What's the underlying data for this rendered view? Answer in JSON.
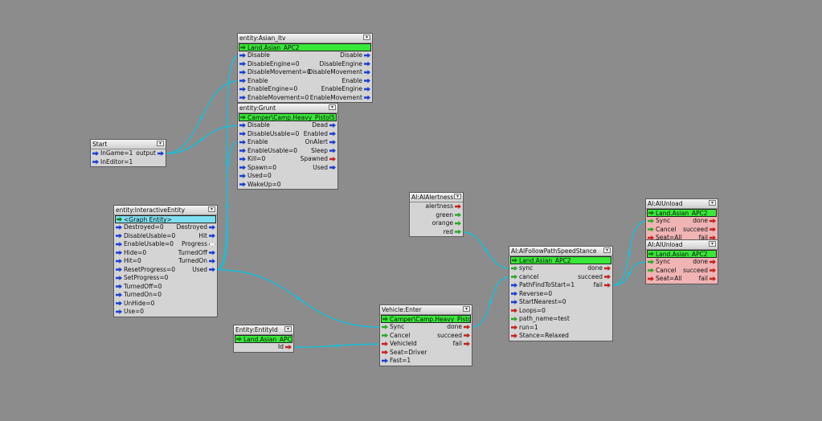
{
  "nodes": {
    "start": {
      "title": "Start",
      "inputs": [
        {
          "label": "InGame=1",
          "color": "blue"
        },
        {
          "label": "InEditor=1",
          "color": "blue"
        }
      ],
      "outputs": [
        {
          "label": "output",
          "color": "blue"
        }
      ]
    },
    "asian_ltv": {
      "title": "entity:Asian_ltv",
      "entity": "Land.Asian_APC2",
      "inputs": [
        {
          "label": "Disable",
          "color": "blue"
        },
        {
          "label": "DisableEngine=0",
          "color": "blue"
        },
        {
          "label": "DisableMovement=0",
          "color": "blue"
        },
        {
          "label": "Enable",
          "color": "blue"
        },
        {
          "label": "EnableEngine=0",
          "color": "blue"
        },
        {
          "label": "EnableMovement=0",
          "color": "blue"
        }
      ],
      "outputs": [
        {
          "label": "Disable",
          "color": "blue"
        },
        {
          "label": "DisableEngine",
          "color": "blue"
        },
        {
          "label": "DisableMovement",
          "color": "blue"
        },
        {
          "label": "Enable",
          "color": "blue"
        },
        {
          "label": "EnableEngine",
          "color": "blue"
        },
        {
          "label": "EnableMovement",
          "color": "blue"
        }
      ]
    },
    "grunt": {
      "title": "entity:Grunt",
      "entity": "Camper\\Camp.Heavy_Pistol5",
      "inputs": [
        {
          "label": "Disable",
          "color": "blue"
        },
        {
          "label": "DisableUsable=0",
          "color": "blue"
        },
        {
          "label": "Enable",
          "color": "blue"
        },
        {
          "label": "EnableUsable=0",
          "color": "blue"
        },
        {
          "label": "Kill=0",
          "color": "blue"
        },
        {
          "label": "Spawn=0",
          "color": "blue"
        },
        {
          "label": "Used=0",
          "color": "blue"
        },
        {
          "label": "WakeUp=0",
          "color": "blue"
        }
      ],
      "outputs": [
        {
          "label": "Dead",
          "color": "blue"
        },
        {
          "label": "Enabled",
          "color": "blue"
        },
        {
          "label": "OnAlert",
          "color": "blue"
        },
        {
          "label": "Sleep",
          "color": "blue"
        },
        {
          "label": "Spawned",
          "color": "red"
        },
        {
          "label": "Used",
          "color": "blue"
        }
      ]
    },
    "interactive": {
      "title": "entity:InteractiveEntity",
      "entity": "<Graph Entity>",
      "inputs": [
        {
          "label": "Destroyed=0",
          "color": "blue"
        },
        {
          "label": "DisableUsable=0",
          "color": "blue"
        },
        {
          "label": "EnableUsable=0",
          "color": "blue"
        },
        {
          "label": "Hide=0",
          "color": "blue"
        },
        {
          "label": "Hit=0",
          "color": "blue"
        },
        {
          "label": "ResetProgress=0",
          "color": "blue"
        },
        {
          "label": "SetProgress=0",
          "color": "blue"
        },
        {
          "label": "TurnedOff=0",
          "color": "blue"
        },
        {
          "label": "TurnedOn=0",
          "color": "blue"
        },
        {
          "label": "UnHide=0",
          "color": "blue"
        },
        {
          "label": "Use=0",
          "color": "blue"
        }
      ],
      "outputs": [
        {
          "label": "Destroyed",
          "color": "blue"
        },
        {
          "label": "Hit",
          "color": "blue"
        },
        {
          "label": "Progress",
          "color": "white"
        },
        {
          "label": "TurnedOff",
          "color": "blue"
        },
        {
          "label": "TurnedOn",
          "color": "blue"
        },
        {
          "label": "Used",
          "color": "blue"
        }
      ]
    },
    "entity_id": {
      "title": "Entity:EntityId",
      "entity": "Land.Asian_APC2",
      "inputs": [],
      "outputs": [
        {
          "label": "Id",
          "color": "red"
        }
      ]
    },
    "vehicle_enter": {
      "title": "Vehicle:Enter",
      "entity": "Camper\\Camp.Heavy_Pistol5",
      "inputs": [
        {
          "label": "Sync",
          "color": "green"
        },
        {
          "label": "Cancel",
          "color": "green"
        },
        {
          "label": "VehicleId",
          "color": "red"
        },
        {
          "label": "Seat=Driver",
          "color": "red"
        },
        {
          "label": "Fast=1",
          "color": "blue"
        }
      ],
      "outputs": [
        {
          "label": "done",
          "color": "red"
        },
        {
          "label": "succeed",
          "color": "red"
        },
        {
          "label": "fail",
          "color": "red"
        }
      ]
    },
    "ai_alertness": {
      "title": "AI:AIAlertness",
      "inputs": [],
      "outputs": [
        {
          "label": "alertness",
          "color": "red"
        },
        {
          "label": "green",
          "color": "green"
        },
        {
          "label": "orange",
          "color": "green"
        },
        {
          "label": "red",
          "color": "green"
        }
      ]
    },
    "follow_path": {
      "title": "AI:AIFollowPathSpeedStance",
      "entity": "Land.Asian_APC2",
      "inputs": [
        {
          "label": "sync",
          "color": "green"
        },
        {
          "label": "cancel",
          "color": "green"
        },
        {
          "label": "PathFindToStart=1",
          "color": "blue"
        },
        {
          "label": "Reverse=0",
          "color": "blue"
        },
        {
          "label": "StartNearest=0",
          "color": "blue"
        },
        {
          "label": "Loops=0",
          "color": "red"
        },
        {
          "label": "path_name=test",
          "color": "green"
        },
        {
          "label": "run=1",
          "color": "red"
        },
        {
          "label": "Stance=Relaxed",
          "color": "red"
        }
      ],
      "outputs": [
        {
          "label": "done",
          "color": "red"
        },
        {
          "label": "succeed",
          "color": "red"
        },
        {
          "label": "fail",
          "color": "red"
        }
      ]
    },
    "ai_unload1": {
      "title": "AI:AIUnload",
      "entity": "Land.Asian_APC2",
      "inputs": [
        {
          "label": "Sync",
          "color": "green"
        },
        {
          "label": "Cancel",
          "color": "green"
        },
        {
          "label": "Seat=All",
          "color": "red"
        }
      ],
      "outputs": [
        {
          "label": "done",
          "color": "red"
        },
        {
          "label": "succeed",
          "color": "red"
        },
        {
          "label": "fail",
          "color": "red"
        }
      ]
    },
    "ai_unload2": {
      "title": "AI:AIUnload",
      "entity": "Land.Asian_APC2",
      "inputs": [
        {
          "label": "Sync",
          "color": "green"
        },
        {
          "label": "Cancel",
          "color": "green"
        },
        {
          "label": "Seat=All",
          "color": "red"
        }
      ],
      "outputs": [
        {
          "label": "done",
          "color": "red"
        },
        {
          "label": "succeed",
          "color": "red"
        },
        {
          "label": "fail",
          "color": "red"
        }
      ]
    }
  },
  "colors": {
    "link": "#00c8e8",
    "background": "#8c8c8c",
    "entity_bar": "#38e838",
    "graph_entity_bar": "#7fdff0",
    "red_node": "#f0b4b4"
  },
  "links": [
    {
      "from": "start.output",
      "to": "asian_ltv.Enable"
    },
    {
      "from": "start.output",
      "to": "grunt.Disable"
    },
    {
      "from": "interactive.Used",
      "to": "asian_ltv.Disable"
    },
    {
      "from": "interactive.Used",
      "to": "grunt.Enable"
    },
    {
      "from": "interactive.Used",
      "to": "vehicle_enter.Sync"
    },
    {
      "from": "entity_id.Id",
      "to": "vehicle_enter.VehicleId"
    },
    {
      "from": "ai_alertness.red",
      "to": "follow_path.sync"
    },
    {
      "from": "vehicle_enter.done",
      "to": "follow_path.cancel"
    },
    {
      "from": "follow_path.fail",
      "to": "ai_unload1.Sync"
    },
    {
      "from": "follow_path.fail",
      "to": "ai_unload2.Sync"
    }
  ]
}
